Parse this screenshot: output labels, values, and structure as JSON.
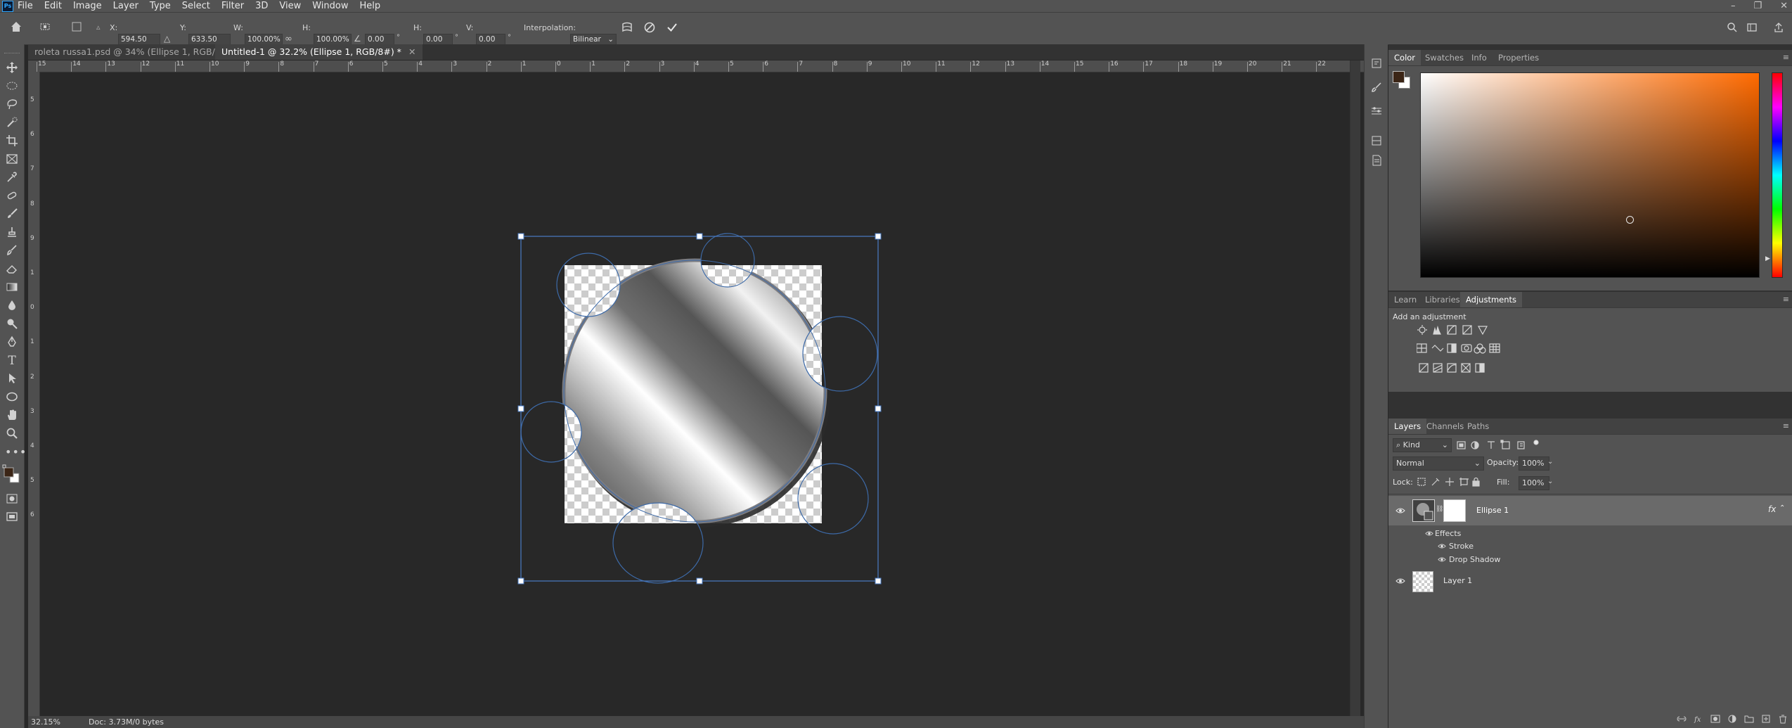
{
  "app": {
    "logo_text": "Ps"
  },
  "menu": [
    "File",
    "Edit",
    "Image",
    "Layer",
    "Type",
    "Select",
    "Filter",
    "3D",
    "View",
    "Window",
    "Help"
  ],
  "window_controls": {
    "minimize": "–",
    "maximize": "❐",
    "close": "✕"
  },
  "options_bar": {
    "x_label": "X:",
    "x_value": "594.50 px",
    "y_label": "Y:",
    "y_value": "633.50 px",
    "w_label": "W:",
    "w_value": "100.00%",
    "h_label": "H:",
    "h_value": "100.00%",
    "angle_value": "0.00",
    "hskew_label": "H:",
    "hskew_value": "0.00",
    "vskew_label": "V:",
    "vskew_value": "0.00",
    "interpolation_label": "Interpolation:",
    "interpolation_value": "Bilinear",
    "degree_symbol": "°"
  },
  "tabs": [
    {
      "label": "roleta russa1.psd @ 34% (Ellipse 1, RGB/8#) *",
      "close": "✕",
      "active": false
    },
    {
      "label": "Untitled-1 @ 32.2% (Ellipse 1, RGB/8#) *",
      "close": "✕",
      "active": true
    }
  ],
  "ruler_h_labels": [
    "15",
    "14",
    "13",
    "12",
    "11",
    "10",
    "9",
    "8",
    "7",
    "6",
    "5",
    "4",
    "3",
    "2",
    "1",
    "0",
    "1",
    "2",
    "3",
    "4",
    "5",
    "6",
    "7",
    "8",
    "9",
    "10",
    "11",
    "12",
    "13",
    "14",
    "15",
    "16",
    "17",
    "18",
    "19",
    "20",
    "21",
    "22"
  ],
  "ruler_v_labels": [
    "5",
    "6",
    "7",
    "8",
    "9",
    "1",
    "0",
    "1",
    "2",
    "3",
    "4",
    "5",
    "6"
  ],
  "status": {
    "zoom": "32.15%",
    "doc": "Doc: 3.73M/0 bytes"
  },
  "color_panel": {
    "tabs": [
      "Color",
      "Swatches",
      "Info",
      "Properties"
    ],
    "active_tab": "Color",
    "foreground": "#3b2516",
    "background": "#ffffff",
    "hue_color": "#ff6a00"
  },
  "adjust_panel": {
    "tabs": [
      "Learn",
      "Libraries",
      "Adjustments"
    ],
    "active_tab": "Adjustments",
    "heading": "Add an adjustment"
  },
  "layers_panel": {
    "tabs": [
      "Layers",
      "Channels",
      "Paths"
    ],
    "active_tab": "Layers",
    "filter_label": "Kind",
    "blend_mode": "Normal",
    "opacity_label": "Opacity:",
    "opacity_value": "100%",
    "lock_label": "Lock:",
    "fill_label": "Fill:",
    "fill_value": "100%",
    "layers": [
      {
        "name": "Ellipse 1",
        "fx": "fx",
        "selected": true
      },
      {
        "name": "Layer 1",
        "selected": false
      }
    ],
    "effects_label": "Effects",
    "effects": [
      "Stroke",
      "Drop Shadow"
    ]
  }
}
